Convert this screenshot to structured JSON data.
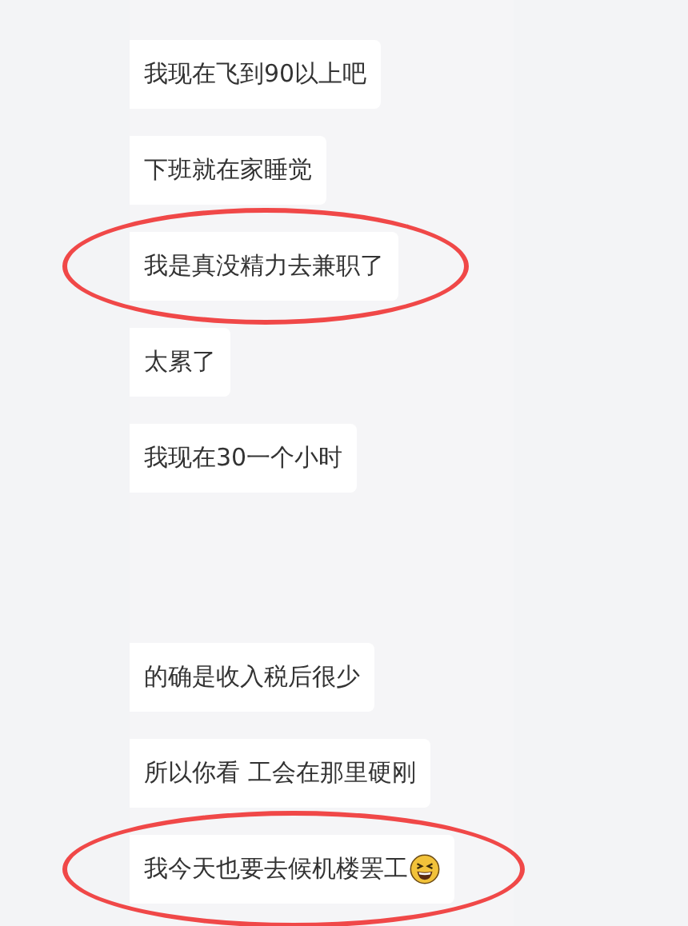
{
  "messages": [
    {
      "kind": "text",
      "text": "我现在飞到90以上吧",
      "circled": false,
      "emoji": false
    },
    {
      "kind": "text",
      "text": "下班就在家睡觉",
      "circled": false,
      "emoji": false
    },
    {
      "kind": "text",
      "text": "我是真没精力去兼职了",
      "circled": true,
      "emoji": false
    },
    {
      "kind": "text",
      "text": "太累了",
      "circled": false,
      "emoji": false
    },
    {
      "kind": "text",
      "text": "我现在30一个小时",
      "circled": false,
      "emoji": false
    },
    {
      "kind": "blank"
    },
    {
      "kind": "text",
      "text": "的确是收入税后很少",
      "circled": false,
      "emoji": false
    },
    {
      "kind": "text",
      "text": "所以你看 工会在那里硬刚",
      "circled": false,
      "emoji": false
    },
    {
      "kind": "text",
      "text": "我今天也要去候机楼罢工",
      "circled": true,
      "emoji": true
    }
  ]
}
